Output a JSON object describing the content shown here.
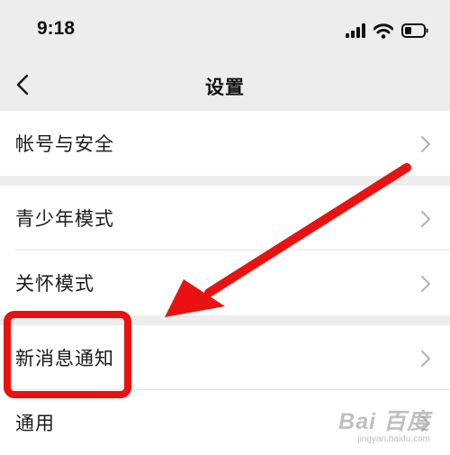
{
  "status_bar": {
    "time": "9:18",
    "icons": [
      "cellular-signal-icon",
      "wifi-icon",
      "battery-icon"
    ]
  },
  "nav": {
    "back_icon": "chevron-left-icon",
    "title": "设置"
  },
  "groups": [
    {
      "items": [
        {
          "label": "帐号与安全",
          "icon": "chevron-right-icon"
        }
      ]
    },
    {
      "items": [
        {
          "label": "青少年模式",
          "icon": "chevron-right-icon"
        },
        {
          "label": "关怀模式",
          "icon": "chevron-right-icon"
        }
      ]
    },
    {
      "items": [
        {
          "label": "新消息通知",
          "icon": "chevron-right-icon"
        },
        {
          "label": "通用",
          "icon": "chevron-right-icon"
        }
      ]
    }
  ],
  "annotation": {
    "highlight_color": "#ea1111",
    "highlighted_item": "新消息通知"
  },
  "watermark": {
    "main": "Bai 百度",
    "sub": "jingyan.baidu.com"
  },
  "colors": {
    "background": "#ededed",
    "row_background": "#ffffff",
    "text": "#1a1a1a",
    "chevron": "#b2b2b2"
  }
}
